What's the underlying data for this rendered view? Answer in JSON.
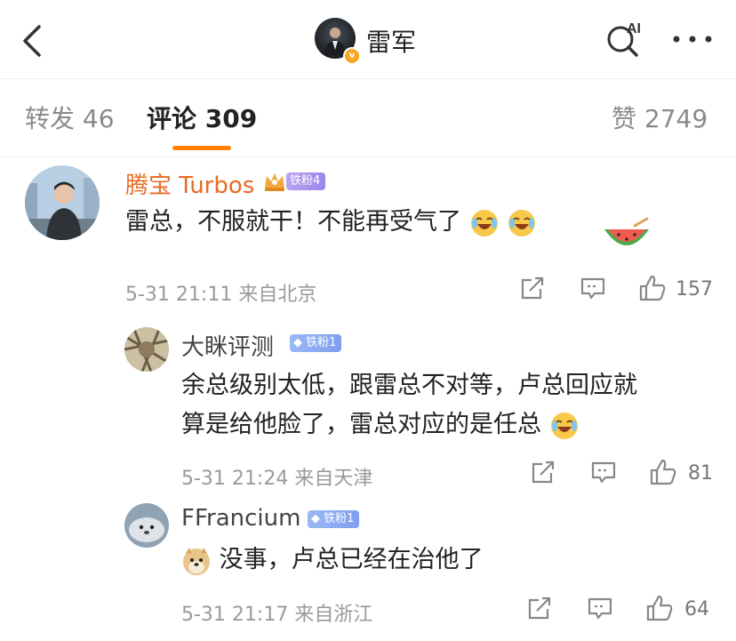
{
  "header": {
    "user_name": "雷军",
    "ai_label": "AI"
  },
  "tabs": [
    {
      "label": "转发 46"
    },
    {
      "label": "评论 309"
    },
    {
      "label": "赞 2749"
    }
  ],
  "comments": [
    {
      "user": "腾宝 Turbos",
      "badge": "铁粉4",
      "text": "雷总，不服就干！不能再受气了",
      "emojis": [
        "laughing-crying-emoji",
        "laughing-crying-emoji"
      ],
      "sticker": "watermelon-sticker",
      "time": "5-31 21:11",
      "location": "来自北京",
      "likes": "157"
    },
    {
      "user": "大眯评测",
      "badge": "铁粉1",
      "text_line1": "余总级别太低，跟雷总不对等，卢总回应就",
      "text_line2": "算是给他脸了，雷总对应的是任总",
      "emojis": [
        "laughing-crying-emoji"
      ],
      "time": "5-31 21:24",
      "location": "来自天津",
      "likes": "81"
    },
    {
      "user": "FFrancium",
      "badge": "铁粉1",
      "emojis": [
        "doge-emoji"
      ],
      "text": "没事，卢总已经在治他了",
      "time": "5-31 21:17",
      "location": "来自浙江",
      "likes": "64"
    }
  ],
  "colors": {
    "accent": "#ff8200",
    "vip_name": "#e86a25",
    "meta": "#9a9a9a"
  }
}
